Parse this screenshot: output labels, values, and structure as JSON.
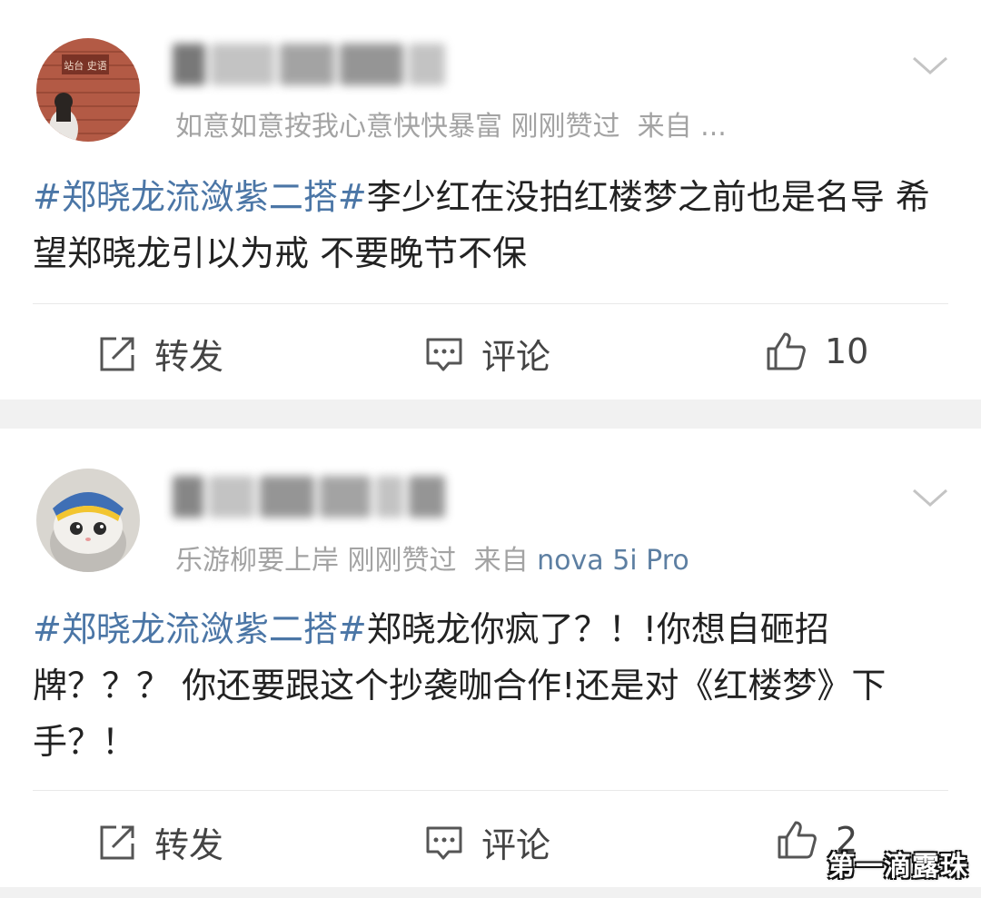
{
  "posts": [
    {
      "username_redacted": "一▇▇▇▇▇",
      "meta_user": "如意如意按我心意快快暴富",
      "meta_status": "刚刚赞过",
      "meta_from": "来自 ...",
      "topic": "#郑晓龙流潋紫二搭#",
      "text": "李少红在没拍红楼梦之前也是名导 希望郑晓龙引以为戒 不要晚节不保",
      "repost_label": "转发",
      "comment_label": "评论",
      "like_count": "10"
    },
    {
      "username_redacted": "▇▇▇▇▇▇▇",
      "meta_user": "乐游柳要上岸",
      "meta_status": "刚刚赞过",
      "meta_from_label": "来自",
      "meta_from_source": "nova 5i Pro",
      "topic": "#郑晓龙流潋紫二搭#",
      "text": "郑晓龙你疯了？！!你想自砸招牌？？？ 你还要跟这个抄袭咖合作!还是对《红楼梦》下手？！",
      "repost_label": "转发",
      "comment_label": "评论",
      "like_count": "2"
    }
  ],
  "watermark": "第一滴露珠",
  "colors": {
    "topic": "#4b76a6",
    "meta": "#a3a3a3",
    "accent": "#ffab1c"
  }
}
